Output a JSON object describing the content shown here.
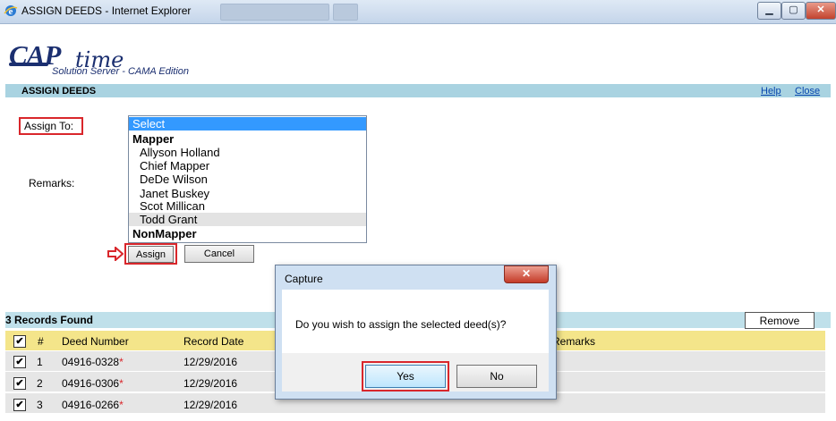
{
  "window": {
    "title": "ASSIGN DEEDS - Internet Explorer",
    "controls": {
      "minimize": "▁",
      "maximize": "▢",
      "close": "✕"
    }
  },
  "logo": {
    "brand": "CAP",
    "brand_script": "time",
    "subtitle": "Solution Server - CAMA Edition",
    "color": "#1b2f70"
  },
  "header": {
    "title": "ASSIGN DEEDS",
    "help_link": "Help",
    "close_link": "Close"
  },
  "form": {
    "assign_to_label": "Assign To:",
    "remarks_label": "Remarks:",
    "options": [
      {
        "label": "Select",
        "kind": "selected"
      },
      {
        "label": "Mapper",
        "kind": "group"
      },
      {
        "label": "Allyson Holland",
        "kind": "item"
      },
      {
        "label": "Chief Mapper",
        "kind": "item"
      },
      {
        "label": "DeDe Wilson",
        "kind": "item"
      },
      {
        "label": "Janet Buskey",
        "kind": "item"
      },
      {
        "label": "Scot Millican",
        "kind": "item"
      },
      {
        "label": "Todd Grant",
        "kind": "hover"
      },
      {
        "label": "NonMapper",
        "kind": "group"
      }
    ],
    "assign_button": "Assign",
    "cancel_button": "Cancel"
  },
  "records": {
    "count_text": "3 Records Found",
    "remove_button": "Remove",
    "columns": {
      "check": "✔",
      "num": "#",
      "deed": "Deed Number",
      "date": "Record Date",
      "remarks": "Remarks"
    },
    "rows": [
      {
        "check": "✔",
        "num": "1",
        "deed": "04916-0328",
        "req": "*",
        "date": "12/29/2016"
      },
      {
        "check": "✔",
        "num": "2",
        "deed": "04916-0306",
        "req": "*",
        "date": "12/29/2016"
      },
      {
        "check": "✔",
        "num": "3",
        "deed": "04916-0266",
        "req": "*",
        "date": "12/29/2016"
      }
    ]
  },
  "dialog": {
    "title": "Capture",
    "close": "✕",
    "message": "Do you wish to assign the selected deed(s)?",
    "yes": "Yes",
    "no": "No"
  },
  "colors": {
    "highlight_red": "#d9262b",
    "header_blue": "#a9d3e1",
    "table_header_yellow": "#f4e58a",
    "link_blue": "#0645ad",
    "select_blue": "#3399ff"
  }
}
